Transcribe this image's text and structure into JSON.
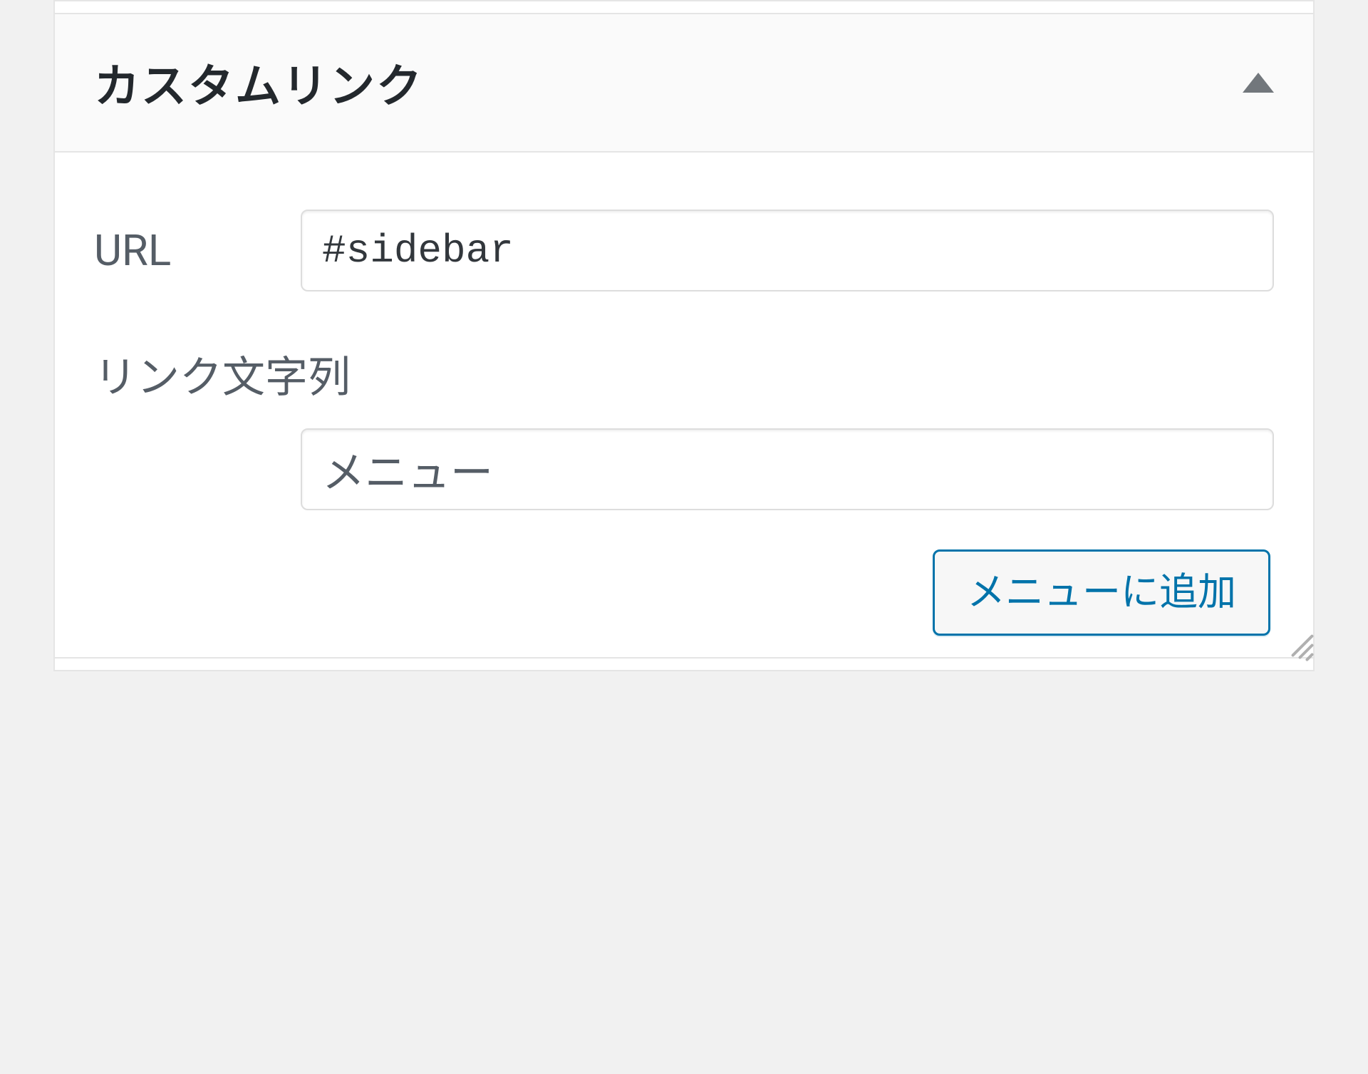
{
  "panel": {
    "title": "カスタムリンク",
    "url_label": "URL",
    "url_value": "#sidebar",
    "link_text_label": "リンク文字列",
    "link_text_value": "メニュー",
    "add_button_label": "メニューに追加"
  }
}
